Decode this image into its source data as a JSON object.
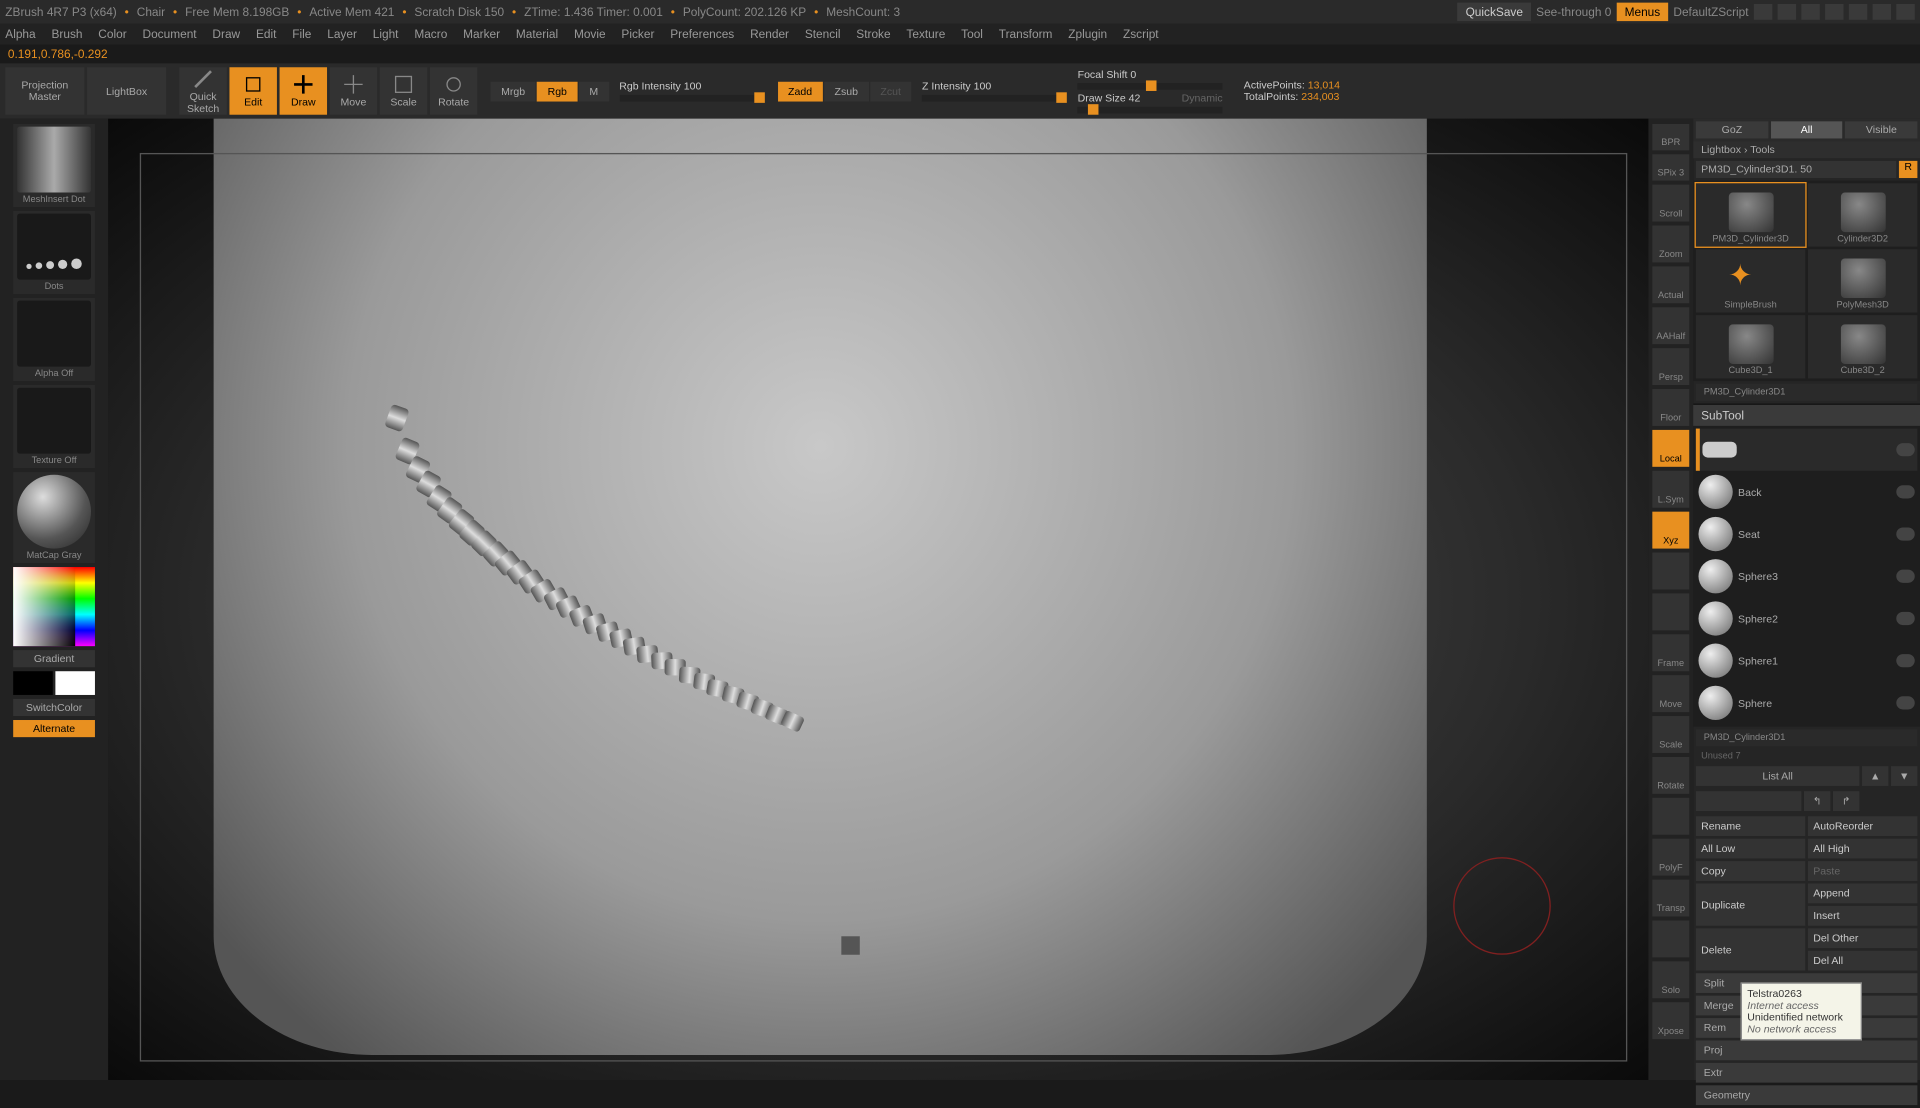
{
  "title": {
    "app": "ZBrush 4R7 P3 (x64)",
    "doc": "Chair",
    "freemem": "Free Mem 8.198GB",
    "activemem": "Active Mem 421",
    "scratch": "Scratch Disk 150",
    "ztime": "ZTime: 1.436 Timer: 0.001",
    "polycount": "PolyCount: 202.126 KP",
    "meshcount": "MeshCount: 3",
    "quicksave": "QuickSave",
    "seethrough": "See-through   0",
    "menus": "Menus",
    "script": "DefaultZScript"
  },
  "menu": [
    "Alpha",
    "Brush",
    "Color",
    "Document",
    "Draw",
    "Edit",
    "File",
    "Layer",
    "Light",
    "Macro",
    "Marker",
    "Material",
    "Movie",
    "Picker",
    "Preferences",
    "Render",
    "Stencil",
    "Stroke",
    "Texture",
    "Tool",
    "Transform",
    "Zplugin",
    "Zscript"
  ],
  "coords": "0.191,0.786,-0.292",
  "toolbar": {
    "projection": "Projection Master",
    "lightbox": "LightBox",
    "quicksketch": "Quick Sketch",
    "edit": "Edit",
    "draw": "Draw",
    "move": "Move",
    "scale": "Scale",
    "rotate": "Rotate",
    "mrgb": "Mrgb",
    "rgb": "Rgb",
    "m": "M",
    "rgbint": "Rgb Intensity 100",
    "zadd": "Zadd",
    "zsub": "Zsub",
    "zcut": "Zcut",
    "zint": "Z Intensity 100",
    "focal": "Focal Shift 0",
    "drawsize": "Draw Size 42",
    "dynamic": "Dynamic",
    "active": "ActivePoints:",
    "activev": "13,014",
    "total": "TotalPoints:",
    "totalv": "234,003"
  },
  "left": {
    "brush": "MeshInsert Dot",
    "stroke": "Dots",
    "alpha": "Alpha Off",
    "texture": "Texture Off",
    "material": "MatCap Gray",
    "gradient": "Gradient",
    "switch": "SwitchColor",
    "alternate": "Alternate"
  },
  "rbtns": [
    "BPR",
    "SPix 3",
    "Scroll",
    "Zoom",
    "Actual",
    "AAHalf",
    "Persp",
    "Floor",
    "Local",
    "L.Sym",
    "Xyz",
    "",
    "",
    "Frame",
    "Move",
    "Scale",
    "Rotate",
    "",
    "PolyF",
    "Transp",
    "",
    "Solo",
    "Xpose"
  ],
  "right": {
    "goz": "GoZ",
    "all": "All",
    "visible": "Visible",
    "crumb": "Lightbox › Tools",
    "toolname": "PM3D_Cylinder3D1. 50",
    "r": "R",
    "tools": [
      "PM3D_Cylinder3D",
      "Cylinder3D2",
      "SimpleBrush",
      "PolyMesh3D",
      "Cube3D_1",
      "Cube3D_2"
    ],
    "longtool": "PM3D_Cylinder3D1",
    "subtool_hdr": "SubTool",
    "subtools": [
      {
        "name": "",
        "active": true
      },
      {
        "name": "Back"
      },
      {
        "name": "Seat"
      },
      {
        "name": "Sphere3"
      },
      {
        "name": "Sphere2"
      },
      {
        "name": "Sphere1"
      },
      {
        "name": "Sphere"
      }
    ],
    "sub_long": "PM3D_Cylinder3D1",
    "unused": "Unused 7",
    "listall": "List All",
    "btns": {
      "rename": "Rename",
      "autoreorder": "AutoReorder",
      "alllow": "All Low",
      "allhigh": "All High",
      "copy": "Copy",
      "paste": "Paste",
      "duplicate": "Duplicate",
      "append": "Append",
      "insert": "Insert",
      "delete": "Delete",
      "delother": "Del Other",
      "delall": "Del All",
      "split": "Split",
      "merge": "Merge",
      "remesh": "Rem",
      "project": "Proj",
      "extract": "Extr",
      "geometry": "Geometry"
    }
  },
  "tooltip": {
    "l1": "Telstra0263",
    "l2": "Internet access",
    "l3": "Unidentified network",
    "l4": "No network access"
  }
}
